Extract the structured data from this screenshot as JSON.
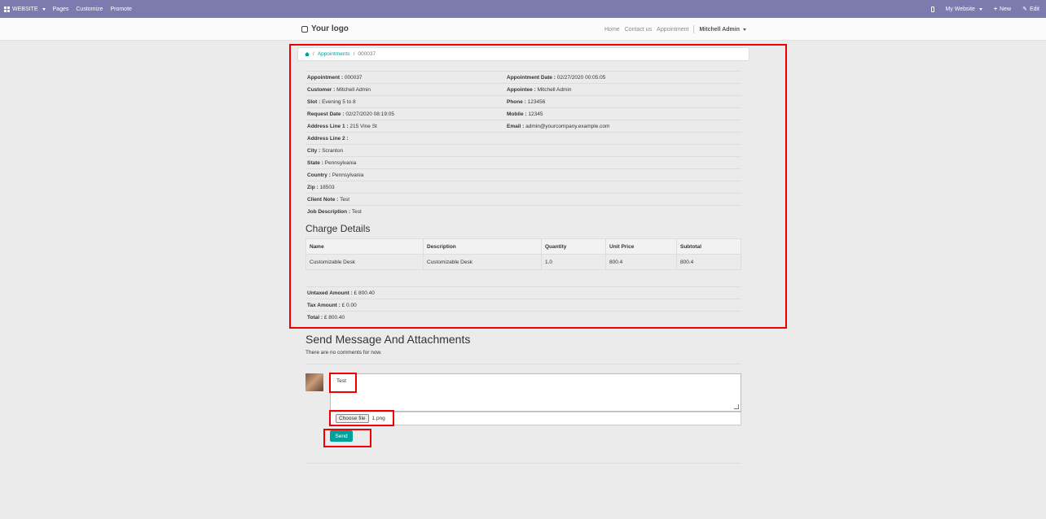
{
  "adminbar": {
    "website_label": "WEBSITE",
    "pages_label": "Pages",
    "customize_label": "Customize",
    "promote_label": "Promote",
    "my_website_label": "My Website",
    "new_label": "New",
    "edit_label": "Edit"
  },
  "header": {
    "logo_text": "Your logo",
    "nav": [
      "Home",
      "Contact us",
      "Appointment"
    ],
    "user_name": "Mitchell Admin"
  },
  "breadcrumb": {
    "items": [
      "Appointments",
      "000037"
    ]
  },
  "details": [
    {
      "l1": "Appointment : ",
      "v1": "000037",
      "l2": "Appointment Date : ",
      "v2": "02/27/2020 00:05:05"
    },
    {
      "l1": "Customer : ",
      "v1": "Mitchell Admin",
      "l2": "Appointee : ",
      "v2": "Mitchell Admin"
    },
    {
      "l1": "Slot : ",
      "v1": "Evening 5 to 8",
      "l2": "Phone : ",
      "v2": "123456"
    },
    {
      "l1": "Request Date : ",
      "v1": "02/27/2020 08:19:05",
      "l2": "Mobile : ",
      "v2": "12345"
    },
    {
      "l1": "Address Line 1 : ",
      "v1": "215 Vine St",
      "l2": "Email : ",
      "v2": "admin@yourcompany.example.com"
    },
    {
      "l1": "Address Line 2 : ",
      "v1": "",
      "l2": "",
      "v2": ""
    },
    {
      "l1": "City : ",
      "v1": "Scranton",
      "l2": "",
      "v2": ""
    },
    {
      "l1": "State : ",
      "v1": "Pennsylvania",
      "l2": "",
      "v2": ""
    },
    {
      "l1": "Country : ",
      "v1": "Pennsylvania",
      "l2": "",
      "v2": ""
    },
    {
      "l1": "Zip : ",
      "v1": "18503",
      "l2": "",
      "v2": ""
    },
    {
      "l1": "Client Note : ",
      "v1": "Test",
      "l2": "",
      "v2": ""
    },
    {
      "l1": "Job Description : ",
      "v1": "Test",
      "l2": "",
      "v2": ""
    }
  ],
  "charge": {
    "title": "Charge Details",
    "columns": [
      "Name",
      "Description",
      "Quantity",
      "Unit Price",
      "Subtotal"
    ],
    "rows": [
      [
        "Customizable Desk",
        "Customizable Desk",
        "1.0",
        "800.4",
        "800.4"
      ]
    ]
  },
  "totals": [
    {
      "label": "Untaxed Amount : ",
      "value": "£ 800.40"
    },
    {
      "label": "Tax Amount : ",
      "value": "£ 0.00"
    },
    {
      "label": "Total : ",
      "value": "£ 800.40"
    }
  ],
  "message": {
    "title": "Send Message And Attachments",
    "no_comments": "There are no comments for now.",
    "textarea_value": "Test",
    "choose_file_label": "Choose file",
    "file_name": "1.png",
    "send_label": "Send"
  },
  "colors": {
    "adminbar_bg": "#7c7bad",
    "accent": "#00a09d",
    "highlight": "#ee0000"
  }
}
